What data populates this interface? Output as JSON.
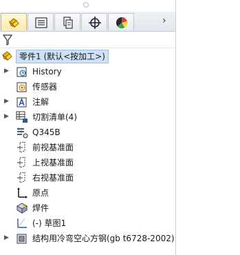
{
  "tabs": [
    {
      "icon": "feature-manager-icon",
      "active": true
    },
    {
      "icon": "property-manager-icon",
      "active": false
    },
    {
      "icon": "configuration-manager-icon",
      "active": false
    },
    {
      "icon": "dimxpert-icon",
      "active": false
    },
    {
      "icon": "display-manager-icon",
      "active": false
    }
  ],
  "tab_more_glyph": "›",
  "root": {
    "label": "零件1  (默认<按加工>)",
    "icon": "part-icon"
  },
  "tree": [
    {
      "label": "History",
      "icon": "history-icon",
      "expandable": true
    },
    {
      "label": "传感器",
      "icon": "sensor-icon",
      "expandable": false
    },
    {
      "label": "注解",
      "icon": "annotation-icon",
      "expandable": true
    },
    {
      "label": "切割清单(4)",
      "icon": "cut-list-icon",
      "expandable": true
    },
    {
      "label": "Q345B",
      "icon": "material-icon",
      "expandable": false
    },
    {
      "label": "前视基准面",
      "icon": "plane-icon",
      "expandable": false
    },
    {
      "label": "上视基准面",
      "icon": "plane-icon",
      "expandable": false
    },
    {
      "label": "右视基准面",
      "icon": "plane-icon",
      "expandable": false
    },
    {
      "label": "原点",
      "icon": "origin-icon",
      "expandable": false
    },
    {
      "label": "焊件",
      "icon": "weldment-icon",
      "expandable": false
    },
    {
      "label": "(-) 草图1",
      "icon": "sketch-icon",
      "expandable": false
    },
    {
      "label": "结构用冷弯空心方钢(gb t6728-2002)",
      "icon": "structural-member-icon",
      "expandable": true
    }
  ],
  "colors": {
    "accent": "#f2b600",
    "selection": "#cde1f7"
  }
}
